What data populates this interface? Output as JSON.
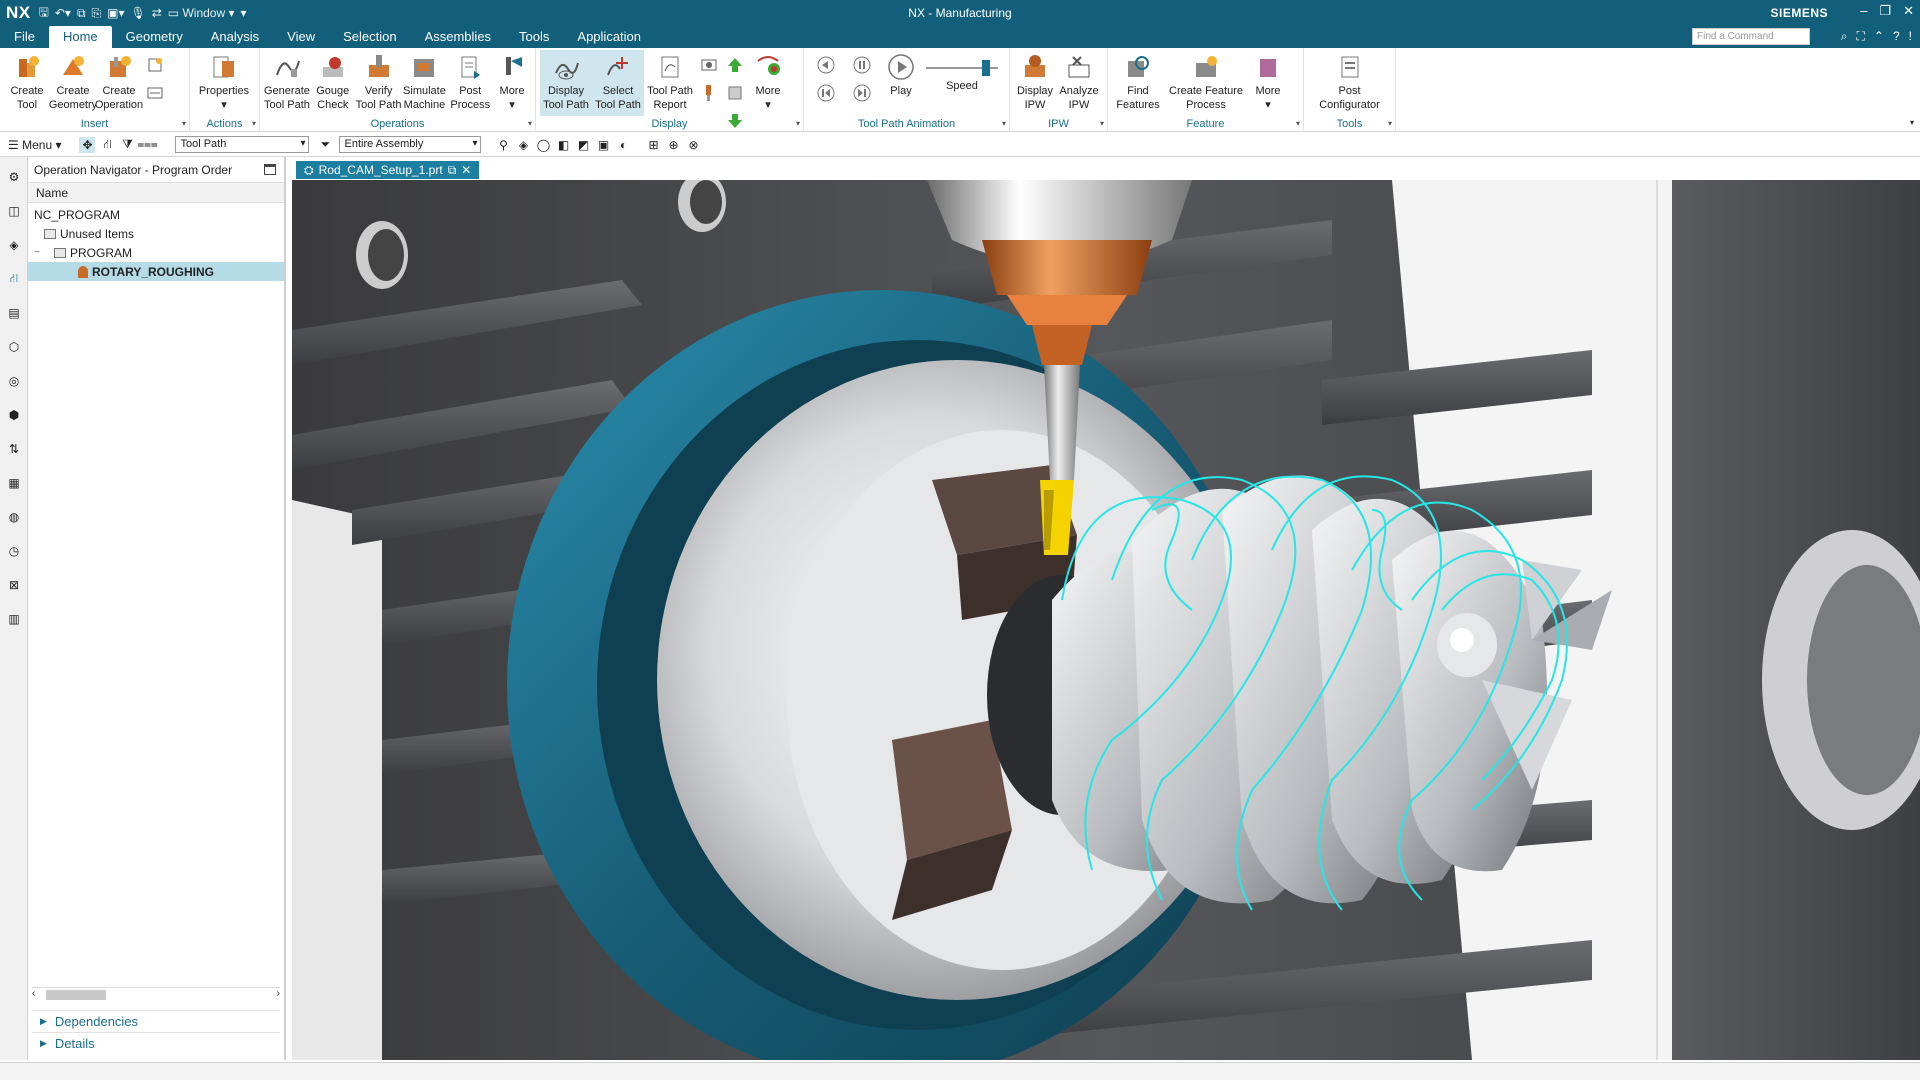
{
  "titlebar": {
    "app_logo": "NX",
    "window_menu": "Window",
    "title": "NX - Manufacturing",
    "brand": "SIEMENS"
  },
  "menu": {
    "tabs": [
      "File",
      "Home",
      "Geometry",
      "Analysis",
      "View",
      "Selection",
      "Assemblies",
      "Tools",
      "Application"
    ],
    "active_tab": "Home",
    "command_search_placeholder": "Find a Command"
  },
  "ribbon": {
    "insert": {
      "title": "Insert",
      "create_tool": "Create\nTool",
      "create_geometry": "Create\nGeometry",
      "create_operation": "Create\nOperation"
    },
    "actions": {
      "title": "Actions",
      "properties": "Properties"
    },
    "operations": {
      "title": "Operations",
      "generate_tool_path": "Generate\nTool Path",
      "gouge_check": "Gouge\nCheck",
      "verify_tool_path": "Verify\nTool Path",
      "simulate_machine": "Simulate\nMachine",
      "post_process": "Post\nProcess",
      "more": "More"
    },
    "display": {
      "title": "Display",
      "display_tool_path": "Display\nTool Path",
      "select_tool_path": "Select\nTool Path",
      "tool_path_report": "Tool Path\nReport",
      "more": "More"
    },
    "animation": {
      "title": "Tool Path Animation",
      "play": "Play",
      "speed": "Speed"
    },
    "ipw": {
      "title": "IPW",
      "display_ipw": "Display\nIPW",
      "analyze_ipw": "Analyze\nIPW"
    },
    "feature": {
      "title": "Feature",
      "find_features": "Find\nFeatures",
      "create_feature_process": "Create Feature\nProcess",
      "more": "More"
    },
    "tools": {
      "title": "Tools",
      "post_configurator": "Post\nConfigurator"
    }
  },
  "toolbar2": {
    "menu_label": "Menu",
    "filter_type": "Tool Path",
    "scope": "Entire Assembly"
  },
  "navigator": {
    "title": "Operation Navigator - Program Order",
    "column_name": "Name",
    "tree": [
      {
        "label": "NC_PROGRAM",
        "level": 0
      },
      {
        "label": "Unused Items",
        "level": 1
      },
      {
        "label": "PROGRAM",
        "level": 1
      },
      {
        "label": "ROTARY_ROUGHING",
        "level": 2,
        "selected": true
      }
    ],
    "footer": [
      "Dependencies",
      "Details"
    ]
  },
  "document": {
    "tab_label": "Rod_CAM_Setup_1.prt"
  },
  "colors": {
    "title_bg": "#115f7a",
    "accent": "#1a6f8c",
    "selection": "#b5dbe7",
    "chuck_ring": "#1d6a85",
    "toolpath": "#27e6e6",
    "tool_holder": "#c96a2a",
    "tool_tip": "#f4d300"
  }
}
